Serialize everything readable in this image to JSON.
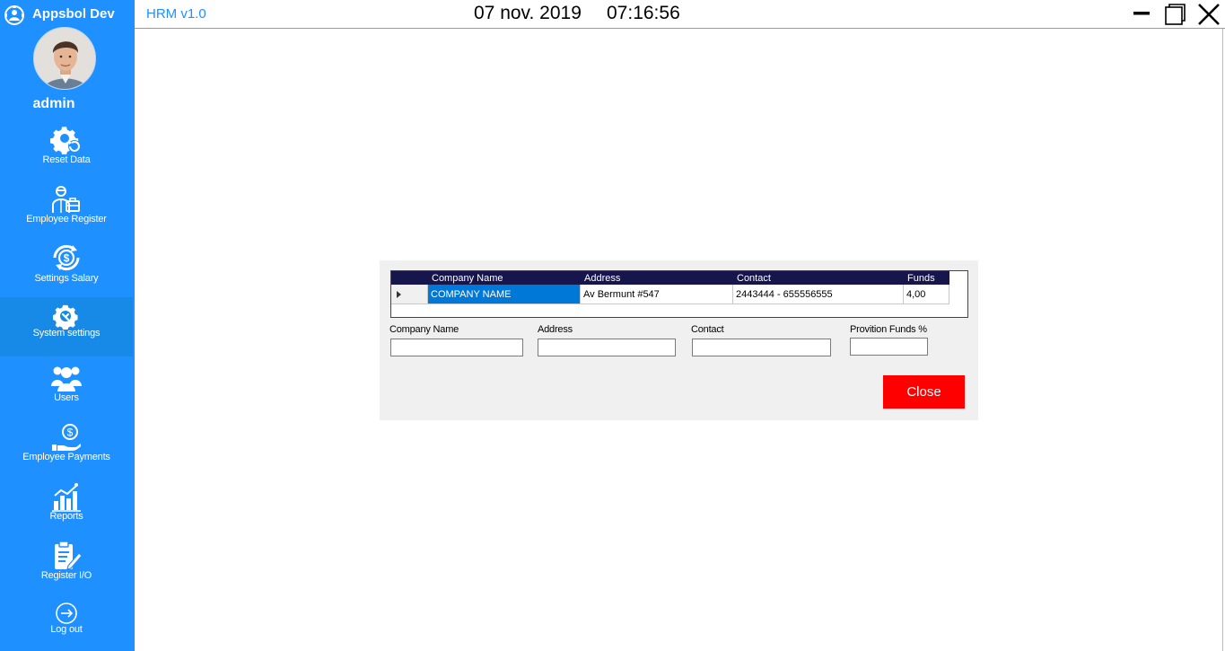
{
  "brand": {
    "name": "Appsbol Dev"
  },
  "user": {
    "name": "admin"
  },
  "sidebar": {
    "items": [
      {
        "label": "Reset Data",
        "icon": "gear-reset-icon"
      },
      {
        "label": "Employee Register",
        "icon": "employee-icon"
      },
      {
        "label": "Settings Salary",
        "icon": "salary-settings-icon"
      },
      {
        "label": "System settings",
        "icon": "system-settings-icon",
        "active": true
      },
      {
        "label": "Users",
        "icon": "users-icon"
      },
      {
        "label": "Employee Payments",
        "icon": "payments-icon"
      },
      {
        "label": "Reports",
        "icon": "reports-icon"
      },
      {
        "label": "Register I/O",
        "icon": "clipboard-icon"
      },
      {
        "label": "Log out",
        "icon": "logout-icon"
      }
    ]
  },
  "topbar": {
    "app_version": "HRM v1.0",
    "date": "07 nov. 2019",
    "time": "07:16:56"
  },
  "dialog": {
    "grid": {
      "columns": [
        "Company Name",
        "Address",
        "Contact",
        "Funds"
      ],
      "rows": [
        [
          "COMPANY NAME",
          "Av Bermunt #547",
          "2443444 - 655556555",
          "4,00"
        ]
      ]
    },
    "fields": {
      "company_name_label": "Company Name",
      "company_name_value": "",
      "address_label": "Address",
      "address_value": "",
      "contact_label": "Contact",
      "contact_value": "",
      "funds_label": "Provition Funds %",
      "funds_value": ""
    },
    "close_label": "Close"
  },
  "colors": {
    "sidebar": "#1e90ff",
    "grid_header": "#16164d",
    "selection": "#0078d7",
    "close_button": "#ff0000"
  }
}
